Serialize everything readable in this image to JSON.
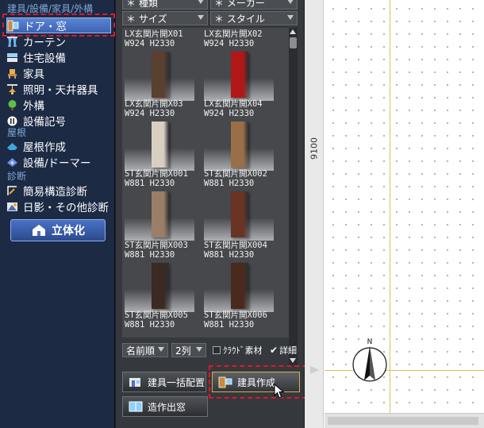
{
  "sidebar": {
    "top_header": "建具/設備/家具/外構",
    "items": [
      {
        "label": "ドア・窓",
        "icon": "door-window-icon",
        "selected": true
      },
      {
        "label": "カーテン",
        "icon": "curtain-icon"
      },
      {
        "label": "住宅設備",
        "icon": "bathtub-icon"
      },
      {
        "label": "家具",
        "icon": "chair-icon"
      },
      {
        "label": "照明・天井器具",
        "icon": "ceiling-light-icon"
      },
      {
        "label": "外構",
        "icon": "tree-icon"
      },
      {
        "label": "設備記号",
        "icon": "outlet-symbol-icon"
      }
    ],
    "roof_header": "屋根",
    "roof_items": [
      {
        "label": "屋根作成",
        "icon": "roof-icon"
      },
      {
        "label": "設備/ドーマー",
        "icon": "dormer-icon"
      }
    ],
    "diag_header": "診断",
    "diag_items": [
      {
        "label": "簡易構造診断",
        "icon": "structure-diagnosis-icon"
      },
      {
        "label": "日影・その他診断",
        "icon": "shadow-diagnosis-icon"
      }
    ],
    "view3d_label": "立体化"
  },
  "panel": {
    "filters": {
      "type": "＊ 種類",
      "maker": "＊ メーカー",
      "size": "＊ サイズ",
      "style": "＊ スタイル"
    },
    "items": [
      {
        "name": "LX玄関片開X01",
        "size": "W924 H2330",
        "color": "#5a4030"
      },
      {
        "name": "LX玄関片開X02",
        "size": "W924 H2330",
        "color": "#b01818"
      },
      {
        "name": "LX玄関片開X03",
        "size": "W924 H2330",
        "color": "#d8cfc2"
      },
      {
        "name": "LX玄関片開X04",
        "size": "W924 H2330",
        "color": "#9a6f48"
      },
      {
        "name": "ST玄関片開X001",
        "size": "W881 H2330",
        "color": "#9b7e68"
      },
      {
        "name": "ST玄関片開X002",
        "size": "W881 H2330",
        "color": "#6a3424"
      },
      {
        "name": "ST玄関片開X003",
        "size": "W881 H2330",
        "color": "#3a2a22"
      },
      {
        "name": "ST玄関片開X004",
        "size": "W881 H2330",
        "color": "#4a2a1c"
      },
      {
        "name": "ST玄関片開X005",
        "size": "W881 H2330",
        "color": "#6b5646"
      },
      {
        "name": "ST玄関片開X006",
        "size": "W881 H2330",
        "color": "#7a624e"
      }
    ],
    "sort": "名前順",
    "columns": "2列",
    "cloud_label": "ｸﾗｳﾄﾞ素材",
    "cloud_checked": false,
    "detail_label": "詳細",
    "detail_checked": true,
    "btn_bulk": "建具一括配置",
    "btn_create": "建具作成",
    "btn_opening": "造作出窓"
  },
  "canvas": {
    "ruler_label": "9100",
    "compass_label": "N"
  },
  "colors": {
    "sidebar_bg": "#1c2a44",
    "selected": "#4a72c4",
    "highlight": "#e0162b",
    "guide_line": "#d7c45a"
  }
}
